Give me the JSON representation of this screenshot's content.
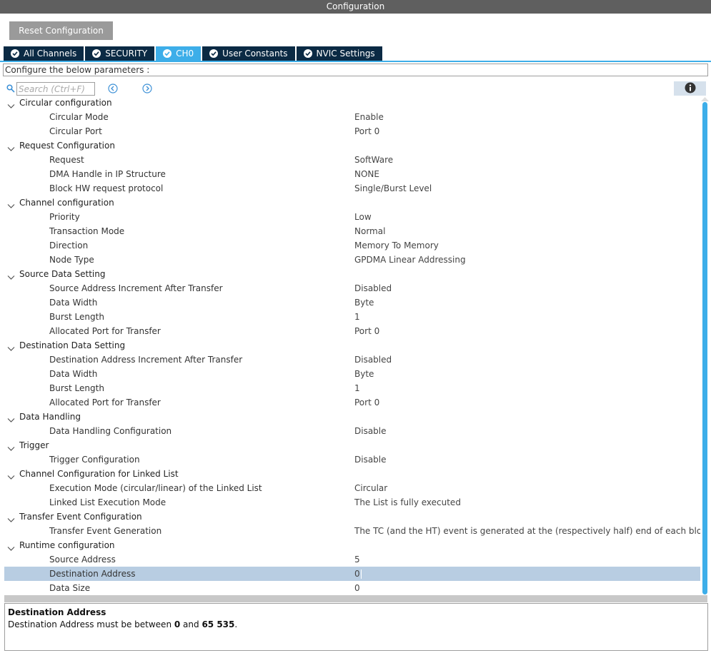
{
  "window": {
    "title": "Configuration"
  },
  "toolbar": {
    "reset_label": "Reset Configuration"
  },
  "tabs": [
    {
      "label": "All Channels",
      "active": false
    },
    {
      "label": "SECURITY",
      "active": false
    },
    {
      "label": "CH0",
      "active": true
    },
    {
      "label": "User Constants",
      "active": false
    },
    {
      "label": "NVIC Settings",
      "active": false
    }
  ],
  "params": {
    "header": "Configure the below parameters :"
  },
  "search": {
    "placeholder": "Search (Ctrl+F)"
  },
  "colors": {
    "accent": "#3daee9",
    "tab_bg": "#0b2a44",
    "title_bg": "#5f5f5f",
    "selected_row": "#b8cde2"
  },
  "tree": [
    {
      "label": "Circular configuration",
      "items": [
        {
          "label": "Circular Mode",
          "value": "Enable"
        },
        {
          "label": "Circular Port",
          "value": "Port 0"
        }
      ]
    },
    {
      "label": "Request Configuration",
      "items": [
        {
          "label": "Request",
          "value": "SoftWare"
        },
        {
          "label": "DMA Handle in IP Structure",
          "value": "NONE"
        },
        {
          "label": "Block HW request protocol",
          "value": "Single/Burst Level"
        }
      ]
    },
    {
      "label": "Channel configuration",
      "items": [
        {
          "label": "Priority",
          "value": "Low"
        },
        {
          "label": "Transaction Mode",
          "value": "Normal"
        },
        {
          "label": "Direction",
          "value": "Memory To Memory"
        },
        {
          "label": "Node Type",
          "value": "GPDMA Linear Addressing"
        }
      ]
    },
    {
      "label": "Source Data Setting",
      "items": [
        {
          "label": "Source Address Increment After Transfer",
          "value": "Disabled"
        },
        {
          "label": "Data Width",
          "value": "Byte"
        },
        {
          "label": "Burst Length",
          "value": "1"
        },
        {
          "label": "Allocated Port for Transfer",
          "value": "Port 0"
        }
      ]
    },
    {
      "label": "Destination Data Setting",
      "items": [
        {
          "label": "Destination Address Increment After Transfer",
          "value": "Disabled"
        },
        {
          "label": "Data Width",
          "value": "Byte"
        },
        {
          "label": "Burst Length",
          "value": "1"
        },
        {
          "label": "Allocated Port for Transfer",
          "value": "Port 0"
        }
      ]
    },
    {
      "label": "Data Handling",
      "items": [
        {
          "label": "Data Handling Configuration",
          "value": "Disable"
        }
      ]
    },
    {
      "label": "Trigger",
      "items": [
        {
          "label": "Trigger Configuration",
          "value": "Disable"
        }
      ]
    },
    {
      "label": "Channel Configuration for Linked List",
      "items": [
        {
          "label": "Execution Mode (circular/linear) of the Linked List",
          "value": "Circular"
        },
        {
          "label": "Linked List Execution Mode",
          "value": "The List is fully executed"
        }
      ]
    },
    {
      "label": "Transfer Event Configuration",
      "items": [
        {
          "label": "Transfer Event Generation",
          "value": "The TC (and the HT) event is generated at the (respectively half) end of each block"
        }
      ]
    },
    {
      "label": "Runtime configuration",
      "items": [
        {
          "label": "Source Address",
          "value": "5"
        },
        {
          "label": "Destination Address",
          "value": "0",
          "selected": true
        },
        {
          "label": "Data Size",
          "value": "0"
        }
      ]
    }
  ],
  "description": {
    "title": "Destination Address",
    "text_prefix": "Destination Address must be between ",
    "min": "0",
    "text_mid": " and ",
    "max": "65 535",
    "text_suffix": "."
  }
}
